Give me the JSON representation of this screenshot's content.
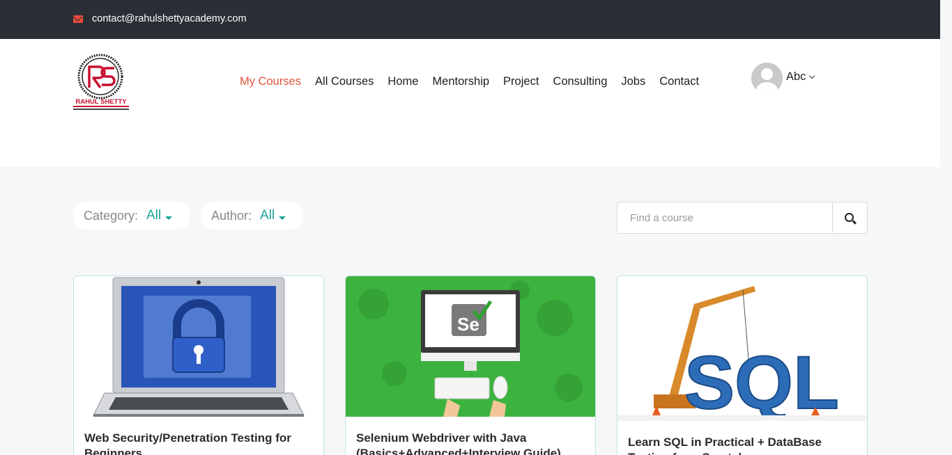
{
  "topbar": {
    "email": "contact@rahulshettyacademy.com"
  },
  "logo": {
    "alt": "RAHUL SHETTY ACADEMY",
    "text": "RAHUL SHETTY"
  },
  "nav": {
    "items": [
      "My Courses",
      "All Courses",
      "Home",
      "Mentorship",
      "Project",
      "Consulting",
      "Jobs",
      "Contact"
    ],
    "active": "My Courses"
  },
  "user": {
    "name": "Abc"
  },
  "filters": {
    "category": {
      "label": "Category:",
      "value": "All"
    },
    "author": {
      "label": "Author:",
      "value": "All"
    }
  },
  "search": {
    "placeholder": "Find a course"
  },
  "courses": [
    {
      "title": "Web Security/Penetration Testing for Beginners"
    },
    {
      "title": "Selenium Webdriver with Java (Basics+Advanced+Interview Guide)"
    },
    {
      "title": "Learn SQL in Practical + DataBase Testing from Scratch"
    }
  ],
  "colors": {
    "accent": "#e0543c",
    "teal": "#19a39a",
    "topbar": "#2a2f35"
  }
}
